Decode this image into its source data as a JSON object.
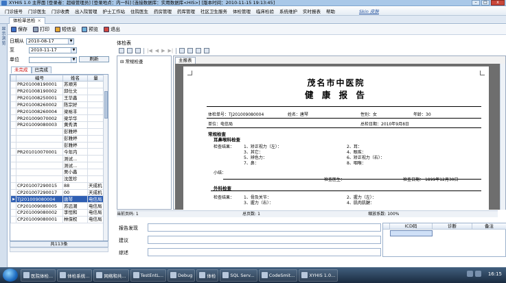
{
  "window": {
    "title": "XYHIS 1.0 主界面  [登录者：超级管理员] [登录地点：内一科] [连接数据库：实用数据库<HIS>] [版本时间：2010-11-15 19:13:45]"
  },
  "menu": [
    "门诊挂号",
    "门诊医生",
    "门诊收费",
    "出入院管理",
    "护士工作站",
    "住院医生",
    "药房管理",
    "药库管理",
    "社区卫生服务",
    "体检管理",
    "临床检验",
    "系统维护",
    "实时报表",
    "帮助"
  ],
  "skin_label": "Skin 皮肤",
  "doc_tab": "体检单总检",
  "left_tool_label": "显示浏览",
  "toolbar": {
    "save": "保存",
    "print": "打印",
    "sms": "短信息",
    "preview": "预览",
    "exit": "退出"
  },
  "filter": {
    "date_from_label": "日期从",
    "date_from": "2010-08-17",
    "date_to_label": "至",
    "date_to": "2010-11-17",
    "unit_label": "单位",
    "refresh": "刷新"
  },
  "subtabs": {
    "pending": "未完成",
    "done": "已完成"
  },
  "grid": {
    "columns": [
      "编号",
      "姓名",
      "量"
    ],
    "rows": [
      [
        "PR201008190001",
        "苏顺芳",
        ""
      ],
      [
        "PR201008190002",
        "邱仕文",
        ""
      ],
      [
        "PR201008250001",
        "王华鑫",
        ""
      ],
      [
        "PR201008260002",
        "陈宗好",
        ""
      ],
      [
        "PR201008260004",
        "梁裕丰",
        ""
      ],
      [
        "PR201009070002",
        "梁华华",
        ""
      ],
      [
        "PR201009080003",
        "黄秀清",
        ""
      ],
      [
        "",
        "彭雅婷",
        ""
      ],
      [
        "",
        "彭雅婷",
        ""
      ],
      [
        "",
        "彭雅婷",
        ""
      ],
      [
        "PR201010070001",
        "今年内",
        ""
      ],
      [
        "",
        "测试...",
        ""
      ],
      [
        "",
        "测试...",
        ""
      ],
      [
        "",
        "吴小鑫",
        ""
      ],
      [
        "",
        "沈莲珍",
        ""
      ],
      [
        "CP201007290015",
        "88",
        "天成机"
      ],
      [
        "CP201007290017",
        "00",
        "天成机"
      ],
      [
        "TJ201009080004",
        "唐琴",
        "电信局"
      ],
      [
        "CP201009080005",
        "苏远潮",
        "电信局"
      ],
      [
        "CP201009080002",
        "李恒和",
        "电信局"
      ],
      [
        "CP201009080001",
        "林保权",
        "电信局"
      ]
    ],
    "selected_index": 17,
    "footer": "共113条"
  },
  "report": {
    "section_label": "体检表",
    "tree_node": "常规检查",
    "tab": "主报表",
    "hospital": "茂名市中医院",
    "title": "健 康 报 告",
    "exam_no_label": "体检单号：",
    "exam_no": "TJ201009080004",
    "name_label": "姓名：",
    "name": "唐琴",
    "sex_label": "性别：",
    "sex": "女",
    "age_label": "年龄：",
    "age": "30",
    "unit_label": "单位：",
    "unit": "电信局",
    "date_label": "总检日期：",
    "date": "2010年9月8日",
    "sec1": "常规检查",
    "sec1_sub": "耳鼻喉科检查",
    "result_label": "检查结果：",
    "ent_items": [
      "1、矫正视力（左）：",
      "2、耳：",
      "3、其它：",
      "4、眼疾：",
      "5、辨色力：",
      "6、矫正视力（右）：",
      "7、鼻：",
      "8、咽喉："
    ],
    "summary_label": "小结：",
    "doctor_label": "检查医生：",
    "check_date_label": "检查日期：",
    "check_date": "1899年12月30日",
    "sec2": "外科检查",
    "surg_items": [
      "1、骨及关节：",
      "2、握力（左）：",
      "3、握力（右）：",
      "4、肌肉肌腱："
    ]
  },
  "status": {
    "page": "当前页码: 1",
    "total": "总页数: 1",
    "zoom": "缩放系数: 100%"
  },
  "bottom": {
    "finding": "报告发现",
    "advice": "建议",
    "summary": "综述"
  },
  "icd": {
    "columns": [
      "ICD码",
      "诊断",
      "备注"
    ]
  },
  "taskbar": {
    "items": [
      "医院体检...",
      "体检系统...",
      "网络和共...",
      "TestEntL...",
      "Debug",
      "体检",
      "SQL Serv...",
      "CodeSmit...",
      "XYHIS 1.0..."
    ],
    "clock": "16:15"
  }
}
